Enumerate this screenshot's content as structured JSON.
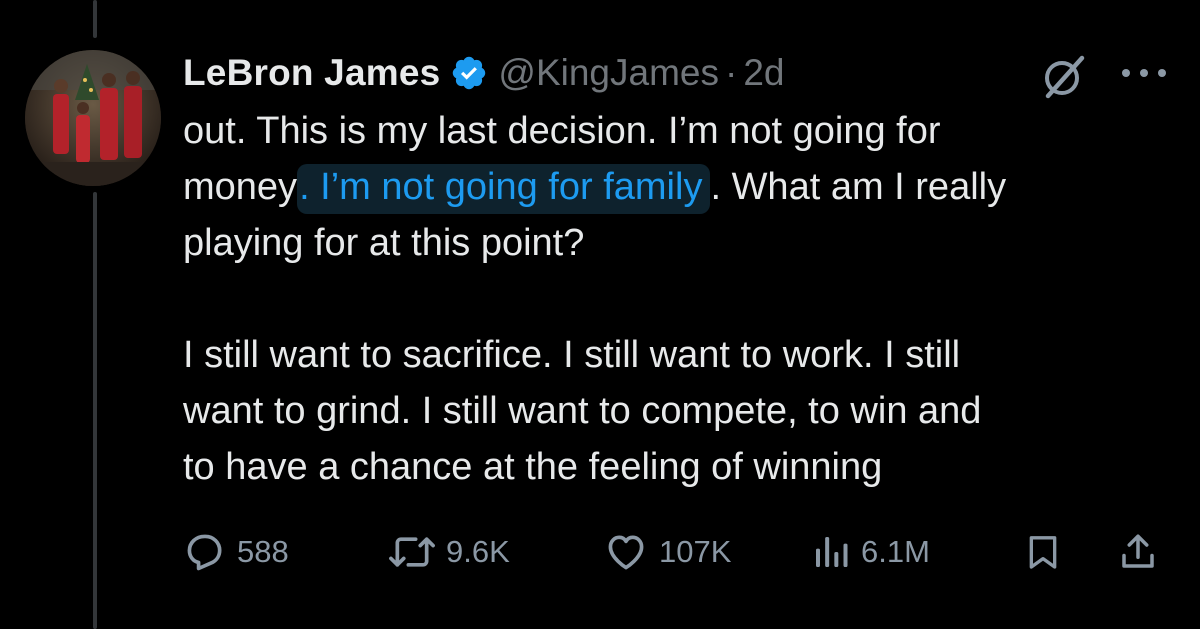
{
  "tweet": {
    "author_name": "LeBron James",
    "handle": "@KingJames",
    "separator": "·",
    "time": "2d",
    "line1": "out. This is my last decision. I’m not going for",
    "line2_start": "money",
    "line2_highlight": ". I’m not going for family",
    "line2_end": ". What am I really",
    "line3": "playing for at this point?",
    "line4": "I still want to sacrifice. I still want to work. I still",
    "line5": "want to grind. I still want to compete, to win and",
    "line6": "to have a chance at the feeling of winning"
  },
  "actions": {
    "replies": "588",
    "reposts": "9.6K",
    "likes": "107K",
    "views": "6.1M"
  },
  "icons": {
    "reply": "reply-icon",
    "repost": "repost-icon",
    "like": "heart-icon",
    "views": "views-icon",
    "bookmark": "bookmark-icon",
    "share": "share-icon",
    "grok": "grok-icon",
    "more": "more-icon",
    "verified": "verified-badge-icon"
  },
  "colors": {
    "background": "#000000",
    "text": "#e7e9ea",
    "muted": "#71767b",
    "link": "#1d9bf0",
    "verified": "#1d9bf0"
  }
}
